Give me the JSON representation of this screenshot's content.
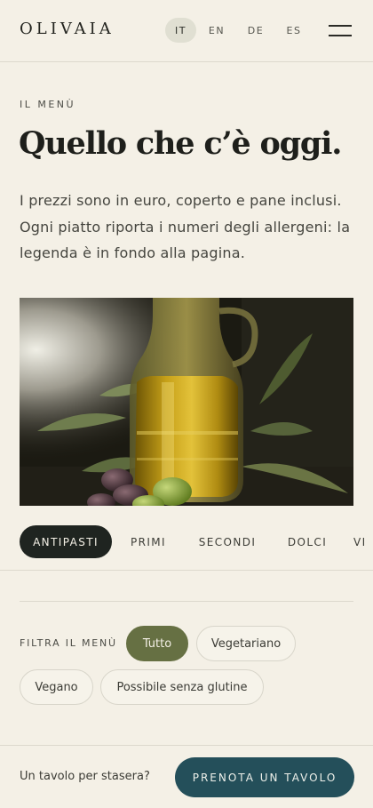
{
  "header": {
    "logo": "OLIVAIA",
    "languages": [
      "IT",
      "EN",
      "DE",
      "ES"
    ],
    "active_language": "IT",
    "menu_icon": "hamburger-menu-icon"
  },
  "intro": {
    "eyebrow": "IL MENÙ",
    "title": "Quello che c’è oggi.",
    "text": "I prezzi sono in euro, coperto e pane inclusi. Ogni piatto riporta i numeri degli allergeni: la legenda è in fondo alla pagina."
  },
  "tabs": [
    "ANTIPASTI",
    "PRIMI",
    "SECONDI",
    "DOLCI",
    "VI"
  ],
  "active_tab": "ANTIPASTI",
  "filters": {
    "label": "FILTRA IL MENÙ",
    "options": [
      "Tutto",
      "Vegetariano",
      "Vegano",
      "Possibile senza glutine"
    ],
    "active": "Tutto"
  },
  "bottom_bar": {
    "prompt": "Un tavolo per stasera?",
    "button": "PRENOTA UN TAVOLO"
  },
  "colors": {
    "background": "#f4f0e6",
    "active_tab": "#1f2420",
    "active_filter": "#667043",
    "reserve_button": "#244f5a"
  }
}
